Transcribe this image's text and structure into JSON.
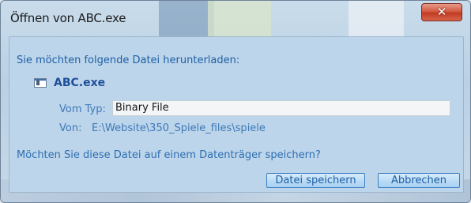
{
  "window": {
    "title": "Öffnen von ABC.exe",
    "close_glyph": "✕"
  },
  "dialog": {
    "prompt": "Sie möchten folgende Datei herunterladen:",
    "file_name": "ABC.exe",
    "file_icon": "exe-file-icon",
    "type_label": "Vom Typ:",
    "type_value": "Binary File",
    "from_label": "Von:",
    "from_value": "E:\\Website\\350_Spiele_files\\spiele",
    "question": "Möchten Sie diese Datei auf einem Datenträger speichern?",
    "save_label": "Datei speichern",
    "cancel_label": "Abbrechen"
  },
  "colors": {
    "accent_text": "#1f5fa6",
    "close_button": "#c23a22",
    "client_background": "#bcd5ea"
  }
}
